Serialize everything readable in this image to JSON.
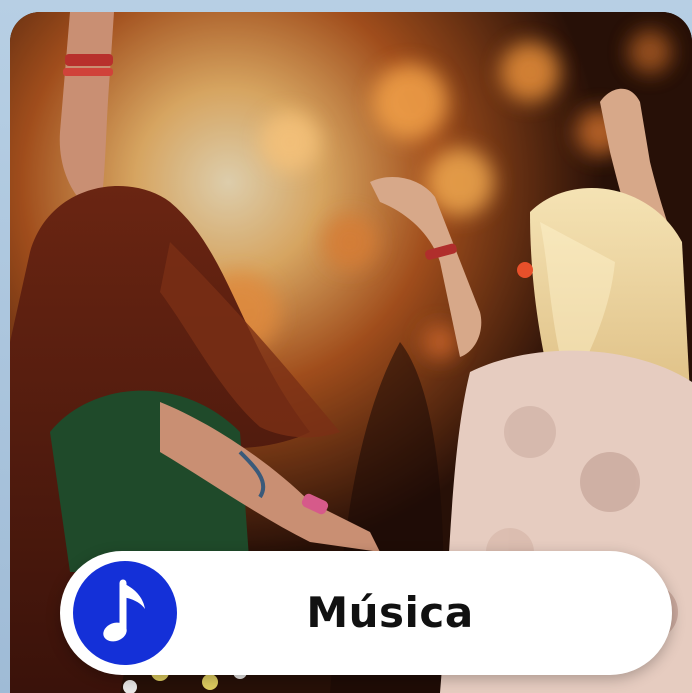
{
  "category": {
    "label": "Música",
    "icon": "music-note-icon",
    "icon_bg_color": "#1430d8"
  }
}
